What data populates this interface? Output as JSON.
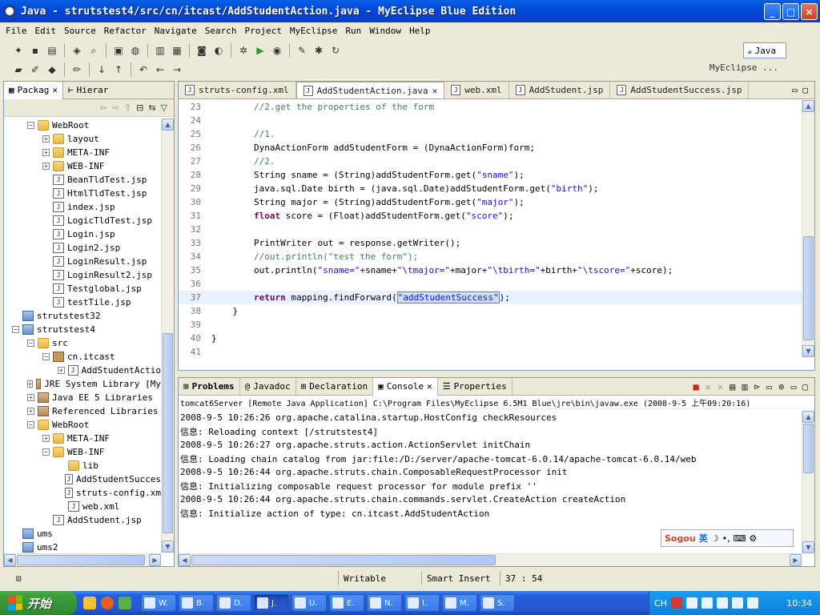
{
  "window": {
    "title": "Java - strutstest4/src/cn/itcast/AddStudentAction.java - MyEclipse Blue Edition",
    "controls": [
      "_",
      "□",
      "×"
    ]
  },
  "menu": [
    "File",
    "Edit",
    "Source",
    "Refactor",
    "Navigate",
    "Search",
    "Project",
    "MyEclipse",
    "Run",
    "Window",
    "Help"
  ],
  "perspective": {
    "active": "Java",
    "other": "MyEclipse ..."
  },
  "explorer": {
    "tabs": [
      "Packag",
      "Hierar"
    ],
    "tree": [
      {
        "label": "WebRoot",
        "icon": "folder",
        "toggle": "−",
        "indent": 1
      },
      {
        "label": "layout",
        "icon": "folder",
        "toggle": "+",
        "indent": 2
      },
      {
        "label": "META-INF",
        "icon": "folder",
        "toggle": "+",
        "indent": 2
      },
      {
        "label": "WEB-INF",
        "icon": "folder",
        "toggle": "+",
        "indent": 2
      },
      {
        "label": "BeanTldTest.jsp",
        "icon": "file",
        "toggle": "",
        "indent": 2
      },
      {
        "label": "HtmlTldTest.jsp",
        "icon": "file",
        "toggle": "",
        "indent": 2
      },
      {
        "label": "index.jsp",
        "icon": "file",
        "toggle": "",
        "indent": 2
      },
      {
        "label": "LogicTldTest.jsp",
        "icon": "file",
        "toggle": "",
        "indent": 2
      },
      {
        "label": "Login.jsp",
        "icon": "file",
        "toggle": "",
        "indent": 2
      },
      {
        "label": "Login2.jsp",
        "icon": "file",
        "toggle": "",
        "indent": 2
      },
      {
        "label": "LoginResult.jsp",
        "icon": "file",
        "toggle": "",
        "indent": 2
      },
      {
        "label": "LoginResult2.jsp",
        "icon": "file",
        "toggle": "",
        "indent": 2
      },
      {
        "label": "Testglobal.jsp",
        "icon": "file",
        "toggle": "",
        "indent": 2
      },
      {
        "label": "testTile.jsp",
        "icon": "file",
        "toggle": "",
        "indent": 2
      },
      {
        "label": "strutstest32",
        "icon": "proj",
        "toggle": "",
        "indent": 0
      },
      {
        "label": "strutstest4",
        "icon": "proj",
        "toggle": "−",
        "indent": 0
      },
      {
        "label": "src",
        "icon": "folder",
        "toggle": "−",
        "indent": 1
      },
      {
        "label": "cn.itcast",
        "icon": "pkg",
        "toggle": "−",
        "indent": 2
      },
      {
        "label": "AddStudentActio",
        "icon": "file",
        "toggle": "+",
        "indent": 3
      },
      {
        "label": "JRE System Library [My",
        "icon": "lib",
        "toggle": "+",
        "indent": 1
      },
      {
        "label": "Java EE 5 Libraries",
        "icon": "lib",
        "toggle": "+",
        "indent": 1
      },
      {
        "label": "Referenced Libraries",
        "icon": "lib",
        "toggle": "+",
        "indent": 1
      },
      {
        "label": "WebRoot",
        "icon": "folder",
        "toggle": "−",
        "indent": 1
      },
      {
        "label": "META-INF",
        "icon": "folder",
        "toggle": "+",
        "indent": 2
      },
      {
        "label": "WEB-INF",
        "icon": "folder",
        "toggle": "−",
        "indent": 2
      },
      {
        "label": "lib",
        "icon": "folder",
        "toggle": "",
        "indent": 3
      },
      {
        "label": "AddStudentSucces",
        "icon": "file",
        "toggle": "",
        "indent": 3
      },
      {
        "label": "struts-config.xm",
        "icon": "file",
        "toggle": "",
        "indent": 3
      },
      {
        "label": "web.xml",
        "icon": "file",
        "toggle": "",
        "indent": 3
      },
      {
        "label": "AddStudent.jsp",
        "icon": "file",
        "toggle": "",
        "indent": 2
      },
      {
        "label": "ums",
        "icon": "proj",
        "toggle": "",
        "indent": 0
      },
      {
        "label": "ums2",
        "icon": "proj",
        "toggle": "",
        "indent": 0
      }
    ]
  },
  "editor": {
    "tabs": [
      {
        "label": "struts-config.xml",
        "active": false
      },
      {
        "label": "AddStudentAction.java",
        "active": true
      },
      {
        "label": "web.xml",
        "active": false
      },
      {
        "label": "AddStudent.jsp",
        "active": false
      },
      {
        "label": "AddStudentSuccess.jsp",
        "active": false
      }
    ],
    "lines": [
      {
        "n": "23",
        "parts": [
          [
            "cm",
            "        //2.get the properties of the form"
          ]
        ]
      },
      {
        "n": "24",
        "parts": []
      },
      {
        "n": "25",
        "parts": [
          [
            "cm",
            "        //1."
          ]
        ]
      },
      {
        "n": "26",
        "parts": [
          [
            "",
            "        DynaActionForm addStudentForm = (DynaActionForm)form;"
          ]
        ]
      },
      {
        "n": "27",
        "parts": [
          [
            "cm",
            "        //2."
          ]
        ]
      },
      {
        "n": "28",
        "parts": [
          [
            "",
            "        String sname = (String)addStudentForm.get("
          ],
          [
            "st",
            "\"sname\""
          ],
          [
            "",
            ");"
          ]
        ]
      },
      {
        "n": "29",
        "parts": [
          [
            "",
            "        java.sql.Date birth = (java.sql.Date)addStudentForm.get("
          ],
          [
            "st",
            "\"birth\""
          ],
          [
            "",
            ");"
          ]
        ]
      },
      {
        "n": "30",
        "parts": [
          [
            "",
            "        String major = (String)addStudentForm.get("
          ],
          [
            "st",
            "\"major\""
          ],
          [
            "",
            ");"
          ]
        ]
      },
      {
        "n": "31",
        "parts": [
          [
            "kw",
            "        float"
          ],
          [
            "",
            " score = (Float)addStudentForm.get("
          ],
          [
            "st",
            "\"score\""
          ],
          [
            "",
            ");"
          ]
        ]
      },
      {
        "n": "32",
        "parts": []
      },
      {
        "n": "33",
        "parts": [
          [
            "",
            "        PrintWriter out = response.getWriter();"
          ]
        ]
      },
      {
        "n": "34",
        "parts": [
          [
            "cm",
            "        //out.println(\"test the form\");"
          ]
        ]
      },
      {
        "n": "35",
        "parts": [
          [
            "",
            "        out.println("
          ],
          [
            "st",
            "\"sname=\""
          ],
          [
            "",
            "+sname+"
          ],
          [
            "st",
            "\"\\tmajor=\""
          ],
          [
            "",
            "+major+"
          ],
          [
            "st",
            "\"\\tbirth=\""
          ],
          [
            "",
            "+birth+"
          ],
          [
            "st",
            "\"\\tscore=\""
          ],
          [
            "",
            "+score);"
          ]
        ]
      },
      {
        "n": "36",
        "parts": []
      },
      {
        "n": "37",
        "parts": [
          [
            "kw",
            "        return"
          ],
          [
            "",
            " mapping.findForward("
          ],
          [
            "st hl",
            "\"addStudentSuccess\""
          ],
          [
            "",
            ");"
          ]
        ],
        "current": true
      },
      {
        "n": "38",
        "parts": [
          [
            "",
            "    }"
          ]
        ]
      },
      {
        "n": "39",
        "parts": []
      },
      {
        "n": "40",
        "parts": [
          [
            "",
            "}"
          ]
        ]
      },
      {
        "n": "41",
        "parts": []
      }
    ]
  },
  "console": {
    "tabs": [
      {
        "label": "Problems",
        "active": false,
        "bold": true
      },
      {
        "label": "Javadoc",
        "active": false
      },
      {
        "label": "Declaration",
        "active": false
      },
      {
        "label": "Console",
        "active": true
      },
      {
        "label": "Properties",
        "active": false
      }
    ],
    "title": "tomcat6Server [Remote Java Application] C:\\Program Files\\MyEclipse 6.5M1 Blue\\jre\\bin\\javaw.exe (2008-9-5 上午09:20:16)",
    "lines": [
      "2008-9-5 10:26:26 org.apache.catalina.startup.HostConfig checkResources",
      "信息: Reloading context [/strutstest4]",
      "2008-9-5 10:26:27 org.apache.struts.action.ActionServlet initChain",
      "信息: Loading chain catalog from jar:file:/D:/server/apache-tomcat-6.0.14/apache-tomcat-6.0.14/web",
      "2008-9-5 10:26:44 org.apache.struts.chain.ComposableRequestProcessor init",
      "信息: Initializing composable request processor for module prefix ''",
      "2008-9-5 10:26:44 org.apache.struts.chain.commands.servlet.CreateAction createAction",
      "信息: Initialize action of type: cn.itcast.AddStudentAction"
    ],
    "ime": {
      "logo": "Sogou",
      "mode": "英"
    }
  },
  "status": {
    "writable": "Writable",
    "insert": "Smart Insert",
    "position": "37 : 54"
  },
  "taskbar": {
    "start": "开始",
    "tasks": [
      "W.",
      "B.",
      "D.",
      "J.",
      "U.",
      "E.",
      "N.",
      "I.",
      "M.",
      "S."
    ],
    "tray_lang": "CH",
    "clock": "10:34"
  }
}
